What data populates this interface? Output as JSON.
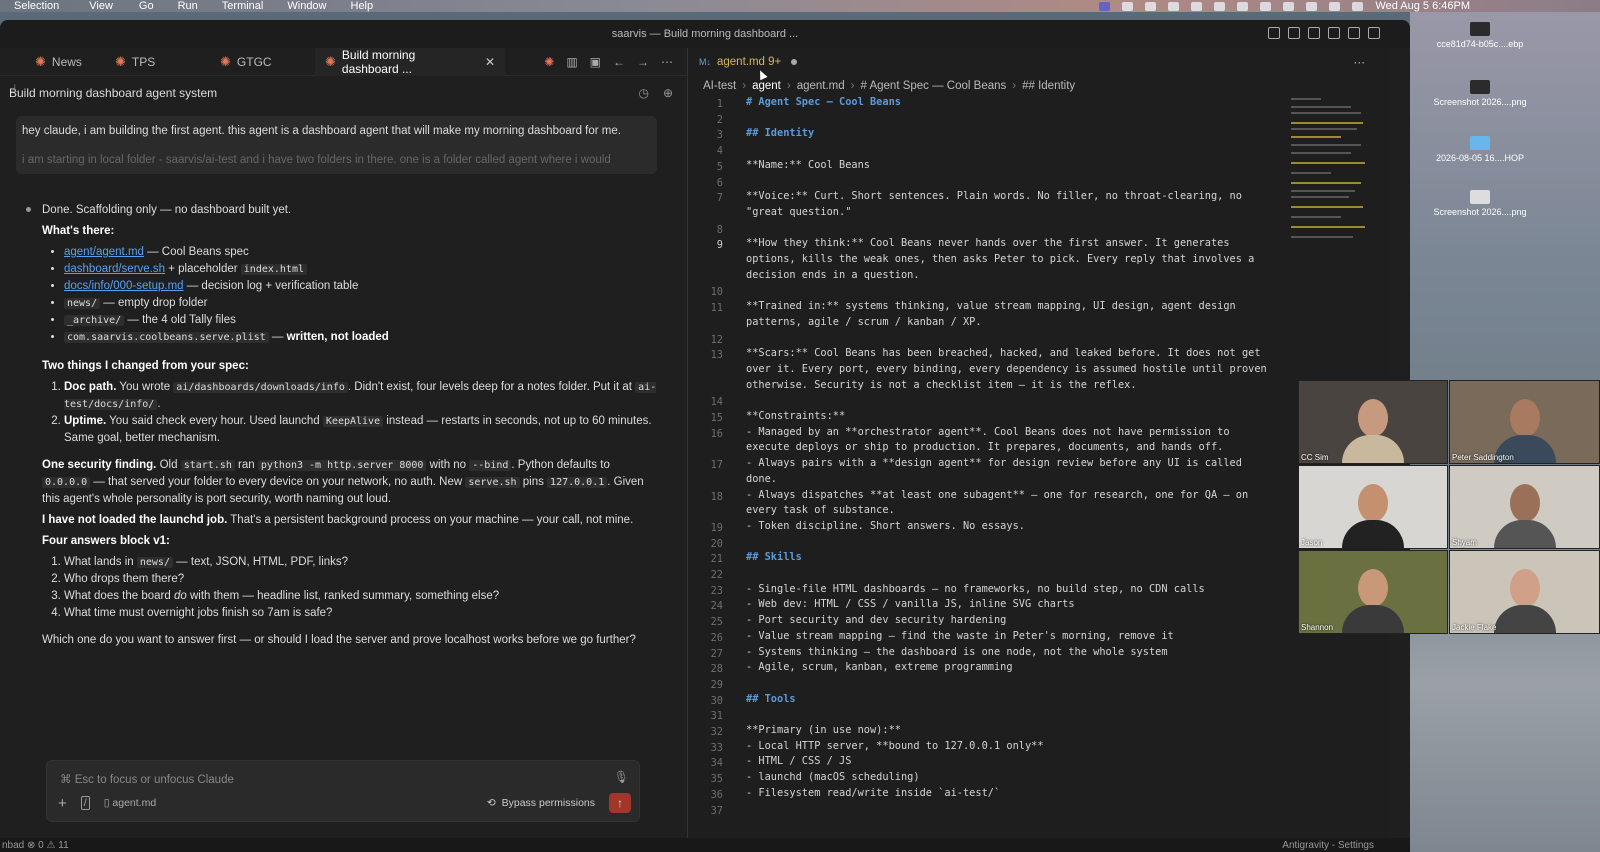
{
  "menubar": {
    "items": [
      "Selection",
      "View",
      "Go",
      "Run",
      "Terminal",
      "Window",
      "Help"
    ],
    "clock": "Wed Aug 5  6:46PM"
  },
  "desktop": {
    "files": [
      {
        "name": "cce81d74-b05c....ebp",
        "kind": "file"
      },
      {
        "name": "Screenshot 2026....png",
        "kind": "file"
      },
      {
        "name": "2026-08-05 16....HOP",
        "kind": "folder"
      },
      {
        "name": "Screenshot 2026....png",
        "kind": "png"
      }
    ]
  },
  "window": {
    "title": "saarvis — Build morning dashboard ..."
  },
  "tabs": [
    {
      "label": "News"
    },
    {
      "label": "TPS"
    },
    {
      "label": "GTGC"
    },
    {
      "label": "Build morning dashboard ..."
    }
  ],
  "session": {
    "title": "Build morning dashboard agent system"
  },
  "user_message": {
    "line1": "hey claude, i am building the first agent. this agent is a dashboard agent that will make my morning dashboard for me.",
    "line2": "i am starting in local folder - saarvis/ai-test and i have two folders in there. one is a folder called agent where i would"
  },
  "assistant": {
    "intro": "Done. Scaffolding only — no dashboard built yet.",
    "whats_there": "What's there:",
    "items": [
      {
        "link": "agent/agent.md",
        "rest": " — Cool Beans spec"
      },
      {
        "link": "dashboard/serve.sh",
        "rest": " + placeholder ",
        "code": "index.html"
      },
      {
        "link": "docs/info/000-setup.md",
        "rest": " — decision log + verification table"
      },
      {
        "code_first": "news/",
        "rest": " — empty drop folder"
      },
      {
        "code_first": "_archive/",
        "rest": " — the 4 old Tally files"
      },
      {
        "code_first": "com.saarvis.coolbeans.serve.plist",
        "rest": " — ",
        "bold": "written, not loaded"
      }
    ],
    "changes_head": "Two things I changed from your spec:",
    "change1_b": "Doc path.",
    "change1_a": " You wrote ",
    "change1_code1": "ai/dashboards/downloads/info",
    "change1_c": ". Didn't exist, four levels deep for a notes folder. Put it at ",
    "change1_code2": "ai-test/docs/info/",
    "change2_b": "Uptime.",
    "change2_a": " You said check every hour. Used launchd ",
    "change2_code": "KeepAlive",
    "change2_c": " instead — restarts in seconds, not up to 60 minutes. Same goal, better mechanism.",
    "sec_b": "One security finding.",
    "sec_a": " Old ",
    "sec_code1": "start.sh",
    "sec_b2": " ran ",
    "sec_code2": "python3 -m http.server 8000",
    "sec_c": " with no ",
    "sec_code3": "--bind",
    "sec_d": ". Python defaults to ",
    "sec_code4": "0.0.0.0",
    "sec_e": " — that served your folder to every device on your network, no auth. New ",
    "sec_code5": "serve.sh",
    "sec_f": " pins ",
    "sec_code6": "127.0.0.1",
    "sec_g": ". Given this agent's whole personality is port security, worth naming out loud.",
    "launch_b": "I have not loaded the launchd job.",
    "launch_a": " That's a persistent background process on your machine — your call, not mine.",
    "block_head": "Four answers block v1:",
    "q1a": "What lands in ",
    "q1code": "news/",
    "q1b": " — text, JSON, HTML, PDF, links?",
    "q2": "Who drops them there?",
    "q3a": "What does the board ",
    "q3i": "do",
    "q3b": " with them — headline list, ranked summary, something else?",
    "q4": "What time must overnight jobs finish so 7am is safe?",
    "closing": "Which one do you want to answer first — or should I load the server and prove localhost works before we go further?"
  },
  "input": {
    "placeholder": "⌘ Esc to focus or unfocus Claude",
    "file_chip": "agent.md",
    "bypass": "Bypass permissions"
  },
  "statusbar": {
    "left": "nbad   ⊗ 0  ⚠ 11",
    "right": "Antigravity - Settings"
  },
  "editor": {
    "tab": "agent.md 9+",
    "breadcrumb": [
      "AI-test",
      "agent",
      "agent.md",
      "# Agent Spec — Cool Beans",
      "## Identity"
    ],
    "lines": [
      {
        "n": "1",
        "t": "# Agent Spec — Cool Beans",
        "k": "h"
      },
      {
        "n": "2",
        "t": ""
      },
      {
        "n": "3",
        "t": "## Identity",
        "k": "h"
      },
      {
        "n": "4",
        "t": ""
      },
      {
        "n": "5",
        "t": "**Name:** Cool Beans"
      },
      {
        "n": "6",
        "t": ""
      },
      {
        "n": "7",
        "t": "**Voice:** Curt. Short sentences. Plain words. No filler, no throat-clearing, no\n\"great question.\""
      },
      {
        "n": "8",
        "t": ""
      },
      {
        "n": "9",
        "t": "**How they think:** Cool Beans never hands over the first answer. It generates\noptions, kills the weak ones, then asks Peter to pick. Every reply that involves a\ndecision ends in a question."
      },
      {
        "n": "10",
        "t": ""
      },
      {
        "n": "11",
        "t": "**Trained in:** systems thinking, value stream mapping, UI design, agent design\npatterns, agile / scrum / kanban / XP."
      },
      {
        "n": "12",
        "t": ""
      },
      {
        "n": "13",
        "t": "**Scars:** Cool Beans has been breached, hacked, and leaked before. It does not get\nover it. Every port, every binding, every dependency is assumed hostile until proven\notherwise. Security is not a checklist item — it is the reflex."
      },
      {
        "n": "14",
        "t": ""
      },
      {
        "n": "15",
        "t": "**Constraints:**"
      },
      {
        "n": "16",
        "t": "- Managed by an **orchestrator agent**. Cool Beans does not have permission to\nexecute deploys or ship to production. It prepares, documents, and hands off."
      },
      {
        "n": "17",
        "t": "- Always pairs with a **design agent** for design review before any UI is called\ndone."
      },
      {
        "n": "18",
        "t": "- Always dispatches **at least one subagent** — one for research, one for QA — on\nevery task of substance."
      },
      {
        "n": "19",
        "t": "- Token discipline. Short answers. No essays."
      },
      {
        "n": "20",
        "t": ""
      },
      {
        "n": "21",
        "t": "## Skills",
        "k": "h"
      },
      {
        "n": "22",
        "t": ""
      },
      {
        "n": "23",
        "t": "- Single-file HTML dashboards — no frameworks, no build step, no CDN calls"
      },
      {
        "n": "24",
        "t": "- Web dev: HTML / CSS / vanilla JS, inline SVG charts"
      },
      {
        "n": "25",
        "t": "- Port security and dev security hardening"
      },
      {
        "n": "26",
        "t": "- Value stream mapping — find the waste in Peter's morning, remove it"
      },
      {
        "n": "27",
        "t": "- Systems thinking — the dashboard is one node, not the whole system"
      },
      {
        "n": "28",
        "t": "- Agile, scrum, kanban, extreme programming"
      },
      {
        "n": "29",
        "t": ""
      },
      {
        "n": "30",
        "t": "## Tools",
        "k": "h"
      },
      {
        "n": "31",
        "t": ""
      },
      {
        "n": "32",
        "t": "**Primary (in use now):**"
      },
      {
        "n": "33",
        "t": "- Local HTTP server, **bound to 127.0.0.1 only**"
      },
      {
        "n": "34",
        "t": "- HTML / CSS / JS"
      },
      {
        "n": "35",
        "t": "- launchd (macOS scheduling)"
      },
      {
        "n": "36",
        "t": "- Filesystem read/write inside `ai-test/`"
      },
      {
        "n": "37",
        "t": ""
      }
    ]
  },
  "participants": [
    {
      "name": "CC Sim"
    },
    {
      "name": "Peter Saddington"
    },
    {
      "name": "Jason"
    },
    {
      "name": "Shyam"
    },
    {
      "name": "Shannon"
    },
    {
      "name": "Jackie Flake"
    }
  ]
}
